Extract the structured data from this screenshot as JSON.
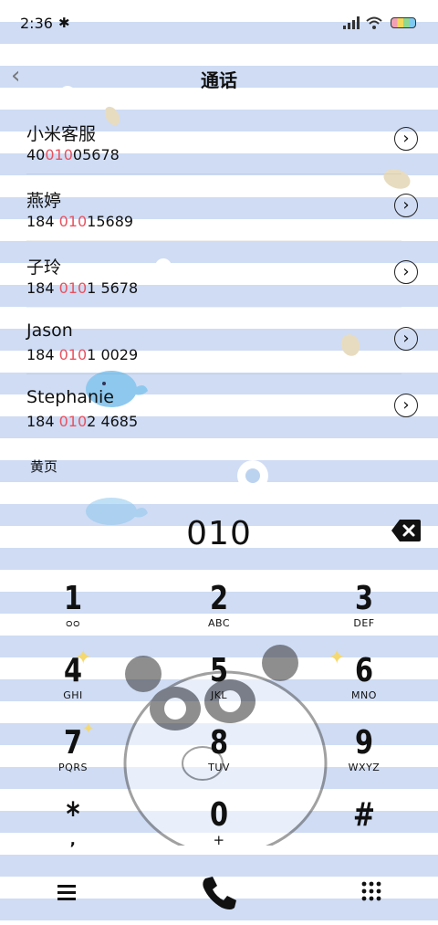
{
  "status_bar": {
    "time": "2:36",
    "bluetooth_icon": "bluetooth-icon",
    "signal_icon": "signal-icon",
    "wifi_icon": "wifi-icon",
    "battery_icon": "battery-icon"
  },
  "header": {
    "title": "通话",
    "back_icon": "chevron-left-icon"
  },
  "contacts": [
    {
      "name": "小米客服",
      "number_pre": "40",
      "number_hl": "010",
      "number_post": "05678"
    },
    {
      "name": "燕婷",
      "number_pre": "184 ",
      "number_hl": "010",
      "number_post": "15689"
    },
    {
      "name": "子玲",
      "number_pre": "184 ",
      "number_hl": "010",
      "number_post": "1 5678"
    },
    {
      "name": "Jason",
      "number_pre": "184 ",
      "number_hl": "010",
      "number_post": "1 0029"
    },
    {
      "name": "Stephanie",
      "number_pre": "184 ",
      "number_hl": "010",
      "number_post": "2 4685"
    }
  ],
  "yellow_pages_label": "黄页",
  "dialer": {
    "number": "010"
  },
  "keys": [
    {
      "digit": "1",
      "letters": ""
    },
    {
      "digit": "2",
      "letters": "ABC"
    },
    {
      "digit": "3",
      "letters": "DEF"
    },
    {
      "digit": "4",
      "letters": "GHI"
    },
    {
      "digit": "5",
      "letters": "JKL"
    },
    {
      "digit": "6",
      "letters": "MNO"
    },
    {
      "digit": "7",
      "letters": "PQRS"
    },
    {
      "digit": "8",
      "letters": "TUV"
    },
    {
      "digit": "9",
      "letters": "WXYZ"
    },
    {
      "digit": "*",
      "letters": ","
    },
    {
      "digit": "0",
      "letters": "+"
    },
    {
      "digit": "#",
      "letters": ""
    }
  ],
  "colors": {
    "highlight": "#e8525f",
    "stripe": "#cfdcf4"
  }
}
